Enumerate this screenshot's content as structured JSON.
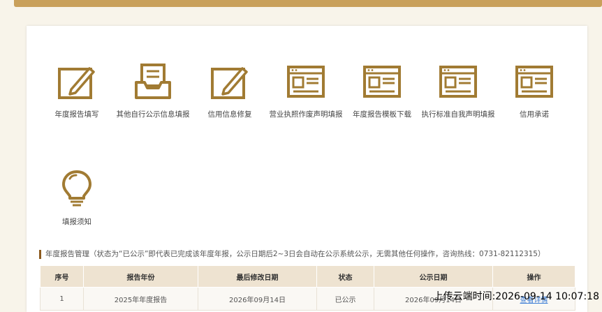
{
  "tiles": [
    {
      "label": "年度报告填写",
      "icon": "edit-icon"
    },
    {
      "label": "其他自行公示信息填报",
      "icon": "inbox-icon"
    },
    {
      "label": "信用信息修复",
      "icon": "edit-icon"
    },
    {
      "label": "营业执照作废声明填报",
      "icon": "document-window-icon"
    },
    {
      "label": "年度报告模板下载",
      "icon": "document-window-icon"
    },
    {
      "label": "执行标准自我声明填报",
      "icon": "document-window-icon"
    },
    {
      "label": "信用承诺",
      "icon": "document-window-icon"
    },
    {
      "label": "填报须知",
      "icon": "lightbulb-icon"
    }
  ],
  "section": {
    "title": "年度报告管理（状态为“已公示”即代表已完成该年度年报，公示日期后2~3日会自动在公示系统公示，无需其他任何操作，咨询热线：0731-82112315）"
  },
  "table": {
    "headers": [
      "序号",
      "报告年份",
      "最后修改日期",
      "状态",
      "公示日期",
      "操作"
    ],
    "rows": [
      [
        "1",
        "2025年年度报告",
        "2026年09月14日",
        "已公示",
        "2026年09月14日",
        "查看详情"
      ]
    ]
  },
  "watermark": "上传云端时间:2026-09-14 10:07:18",
  "colors": {
    "accent": "#a17b33",
    "header_bg": "#eee3d1",
    "topbar": "#c9a05b"
  }
}
